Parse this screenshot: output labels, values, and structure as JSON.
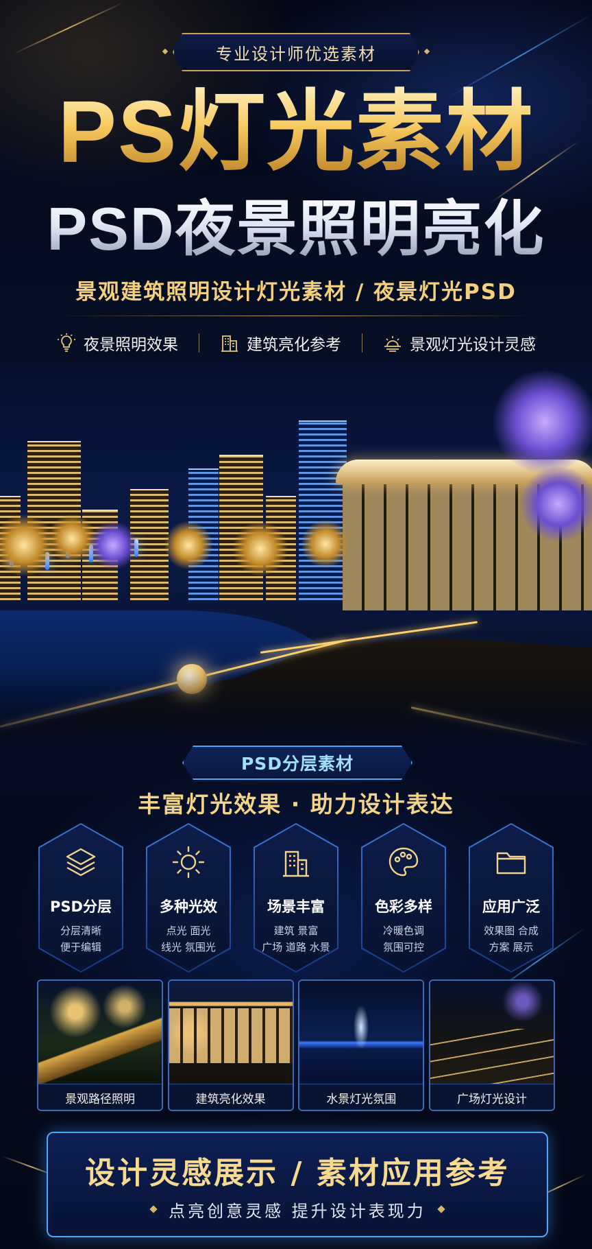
{
  "header": {
    "badge": "专业设计师优选素材",
    "title_line1": "PS灯光素材",
    "title_line2": "PSD夜景照明亮化",
    "subtitle": "景观建筑照明设计灯光素材 / 夜景灯光PSD"
  },
  "features": [
    {
      "icon": "lightbulb-icon",
      "label": "夜景照明效果"
    },
    {
      "icon": "building-icon",
      "label": "建筑亮化参考"
    },
    {
      "icon": "sunrise-icon",
      "label": "景观灯光设计灵感"
    }
  ],
  "section": {
    "badge": "PSD分层素材",
    "tagline": "丰富灯光效果 · 助力设计表达"
  },
  "cards": [
    {
      "icon": "layers-icon",
      "title": "PSD分层",
      "line1": "分层清晰",
      "line2": "便于编辑"
    },
    {
      "icon": "sun-icon",
      "title": "多种光效",
      "line1": "点光  面光",
      "line2": "线光  氛围光"
    },
    {
      "icon": "buildings-icon",
      "title": "场景丰富",
      "line1": "建筑  景富",
      "line2": "广场 道路 水景"
    },
    {
      "icon": "palette-icon",
      "title": "色彩多样",
      "line1": "冷暖色调",
      "line2": "氛围可控"
    },
    {
      "icon": "folder-icon",
      "title": "应用广泛",
      "line1": "效果图  合成",
      "line2": "方案  展示"
    }
  ],
  "photos": [
    {
      "caption": "景观路径照明"
    },
    {
      "caption": "建筑亮化效果"
    },
    {
      "caption": "水景灯光氛围"
    },
    {
      "caption": "广场灯光设计"
    }
  ],
  "banner": {
    "title": "设计灵感展示 / 素材应用参考",
    "subtitle": "点亮创意灵感   提升设计表现力"
  },
  "colors": {
    "gold": "#f4cf7c",
    "blue_accent": "#4aa8ff",
    "background": "#050a1c"
  }
}
